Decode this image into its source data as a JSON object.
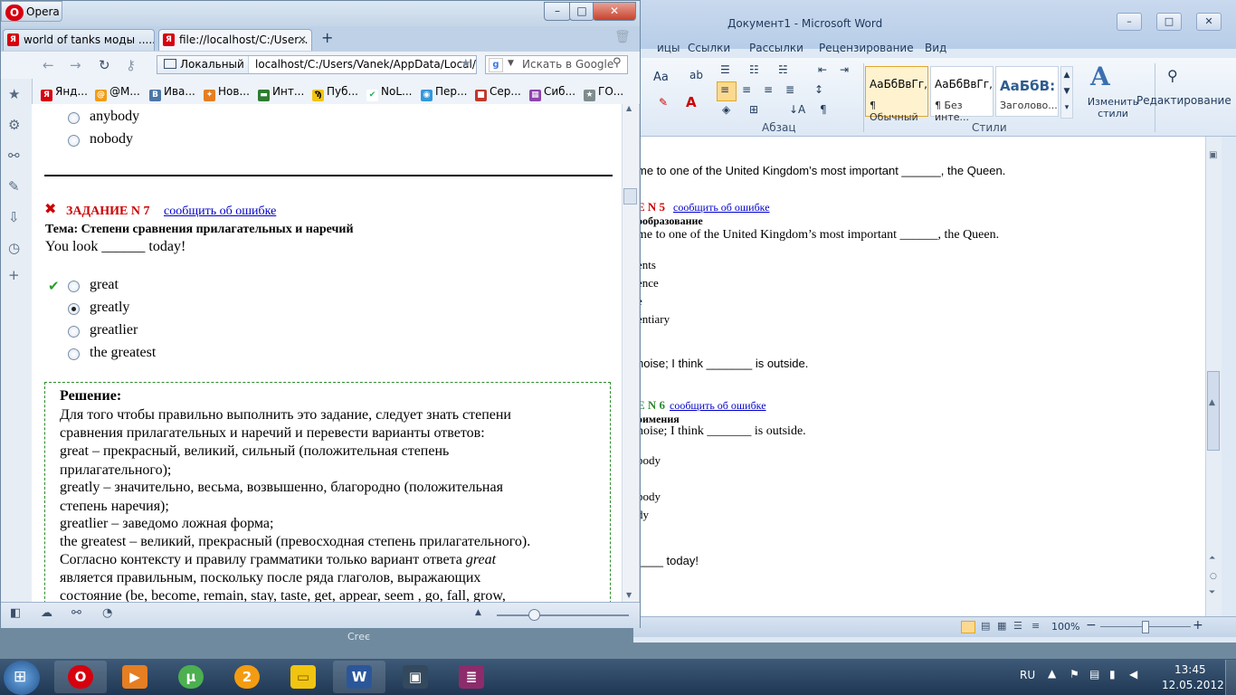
{
  "word": {
    "title": "Документ1 - Microsoft Word",
    "window_buttons": [
      "–",
      "□",
      "✕"
    ],
    "tabs": [
      "ицы",
      "Ссылки",
      "Рассылки",
      "Рецензирование",
      "Вид"
    ],
    "ribbon": {
      "font_size_btn": "Aa",
      "styles": [
        {
          "sample": "АаБбВвГг,",
          "name": "¶ Обычный"
        },
        {
          "sample": "АаБбВвГг,",
          "name": "¶ Без инте..."
        },
        {
          "sample": "АаБбВ:",
          "name": "Заголово..."
        }
      ],
      "change_styles": "Изменить стили",
      "editing": "Редактирование",
      "group_paragraph": "Абзац",
      "group_styles": "Стили"
    },
    "doc_lines": {
      "l1": "me to one of the United Kingdom’s most important ______, the Queen.",
      "task5_head": "E N 5",
      "task5_link": "сообщить об ошибке",
      "task5_theme": "ообразование",
      "l2": "me to one of the United Kingdom’s most important ______, the Queen.",
      "o1": "ents",
      "o2": "ence",
      "o3": "e",
      "o4": "entiary",
      "l3": "noise; I think _______ is outside.",
      "task6_head": "E N 6",
      "task6_link": "сообщить об ошибке",
      "task6_theme": "оимения",
      "l4": "noise; I think _______ is outside.",
      "o5": "body",
      "o6": "body",
      "o7": "dy",
      "l5": "____ today!"
    },
    "status": {
      "zoom": "100%",
      "minus": "−",
      "plus": "+"
    }
  },
  "opera": {
    "app_button": "Opera",
    "window_buttons": [
      "–",
      "□",
      "✕"
    ],
    "tabs": [
      {
        "label": "world of tanks моды ......",
        "close": "✕"
      },
      {
        "label": "file://localhost/C:/User...",
        "close": "✕"
      }
    ],
    "new_tab": "+",
    "address": {
      "zone": "Локальный",
      "url": "localhost/C:/Users/Vanek/AppData/Local/"
    },
    "search": {
      "placeholder": "Искать в Google"
    },
    "bookmarks": [
      "Янд...",
      "@M...",
      "Ива...",
      "Нов...",
      "Инт...",
      "Пуб...",
      "NoL...",
      "Пер...",
      "Сер...",
      "Сиб...",
      "ГО..."
    ],
    "page": {
      "prev_options": [
        "anybody",
        "nobody"
      ],
      "task_title": "ЗАДАНИЕ N 7",
      "report_link": "сообщить об ошибке",
      "theme": "Тема: Степени сравнения прилагательных и наречий",
      "question": "You look ______ today!",
      "options": [
        {
          "label": "great",
          "selected": false,
          "correct": true
        },
        {
          "label": "greatly",
          "selected": true,
          "correct": false
        },
        {
          "label": "greatlier",
          "selected": false,
          "correct": false
        },
        {
          "label": "the greatest",
          "selected": false,
          "correct": false
        }
      ],
      "solution": {
        "header": "Решение:",
        "lines": [
          "Для того чтобы правильно выполнить это задание, следует знать степени",
          "сравнения прилагательных и наречий и перевести варианты ответов:",
          "great – прекрасный, великий, сильный (положительная степень",
          "прилагательного);",
          "greatly – значительно, весьма, возвышенно, благородно (положительная",
          "степень наречия);",
          "greatlier – заведомо ложная форма;",
          "the greatest – великий, прекрасный (превосходная степень прилагательного).",
          "Согласно контексту и правилу грамматики только вариант ответа",
          "является правильным, поскольку после ряда глаголов, выражающих",
          "состояние (be, become, remain, stay, taste, get, appear, seem , go, fall, grow,"
        ],
        "emphasis_word": "great"
      }
    }
  },
  "taskbar": {
    "lang": "RU",
    "time": "13:45",
    "date": "12.05.2012",
    "word_label": "W"
  },
  "colors": {
    "task_red": "#cc0000",
    "link_blue": "#0000cc",
    "correct_green": "#2e9e2e",
    "solution_border": "#2e8b2e"
  }
}
